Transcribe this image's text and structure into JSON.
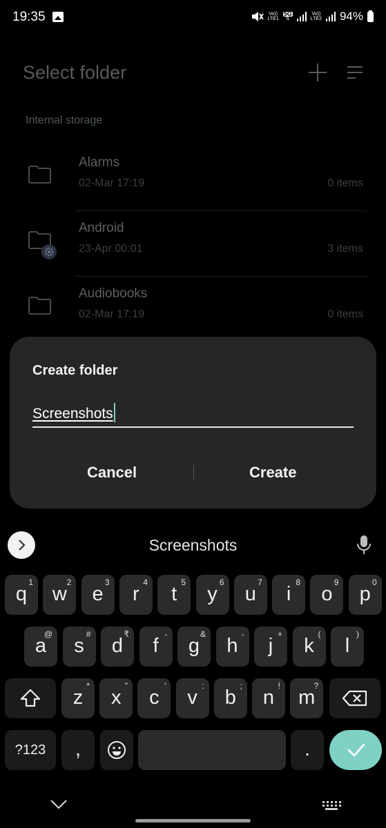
{
  "status_bar": {
    "time": "19:35",
    "sim1_top": "Vo))",
    "sim1_bottom": "LTE1",
    "network_top": "5G",
    "sim2_top": "Vo))",
    "sim2_bottom": "LTE2",
    "battery": "94%"
  },
  "header": {
    "title": "Select folder",
    "add_icon": "plus-icon",
    "sort_icon": "sort-icon"
  },
  "storage_label": "Internal storage",
  "folders": [
    {
      "name": "Alarms",
      "date": "02-Mar 17:19",
      "count": "0 items"
    },
    {
      "name": "Android",
      "date": "23-Apr 00:01",
      "count": "3 items"
    },
    {
      "name": "Audiobooks",
      "date": "02-Mar 17:19",
      "count": "0 items"
    }
  ],
  "dialog": {
    "title": "Create folder",
    "input_value": "Screenshots",
    "cancel_label": "Cancel",
    "create_label": "Create"
  },
  "keyboard": {
    "suggestion": "Screenshots",
    "row1": [
      {
        "key": "q",
        "hint": "1"
      },
      {
        "key": "w",
        "hint": "2"
      },
      {
        "key": "e",
        "hint": "3"
      },
      {
        "key": "r",
        "hint": "4"
      },
      {
        "key": "t",
        "hint": "5"
      },
      {
        "key": "y",
        "hint": "6"
      },
      {
        "key": "u",
        "hint": "7"
      },
      {
        "key": "i",
        "hint": "8"
      },
      {
        "key": "o",
        "hint": "9"
      },
      {
        "key": "p",
        "hint": "0"
      }
    ],
    "row2": [
      {
        "key": "a",
        "hint": "@"
      },
      {
        "key": "s",
        "hint": "#"
      },
      {
        "key": "d",
        "hint": "₹"
      },
      {
        "key": "f",
        "hint": "-"
      },
      {
        "key": "g",
        "hint": "&"
      },
      {
        "key": "h",
        "hint": "-"
      },
      {
        "key": "j",
        "hint": "+"
      },
      {
        "key": "k",
        "hint": "("
      },
      {
        "key": "l",
        "hint": ")"
      }
    ],
    "row3": [
      {
        "key": "z",
        "hint": "*"
      },
      {
        "key": "x",
        "hint": "\""
      },
      {
        "key": "c",
        "hint": "'"
      },
      {
        "key": "v",
        "hint": ":"
      },
      {
        "key": "b",
        "hint": ";"
      },
      {
        "key": "n",
        "hint": "!"
      },
      {
        "key": "m",
        "hint": "?"
      }
    ],
    "symbols_label": "?123",
    "comma": ",",
    "period": "."
  },
  "accent_color": "#7fd1c5"
}
